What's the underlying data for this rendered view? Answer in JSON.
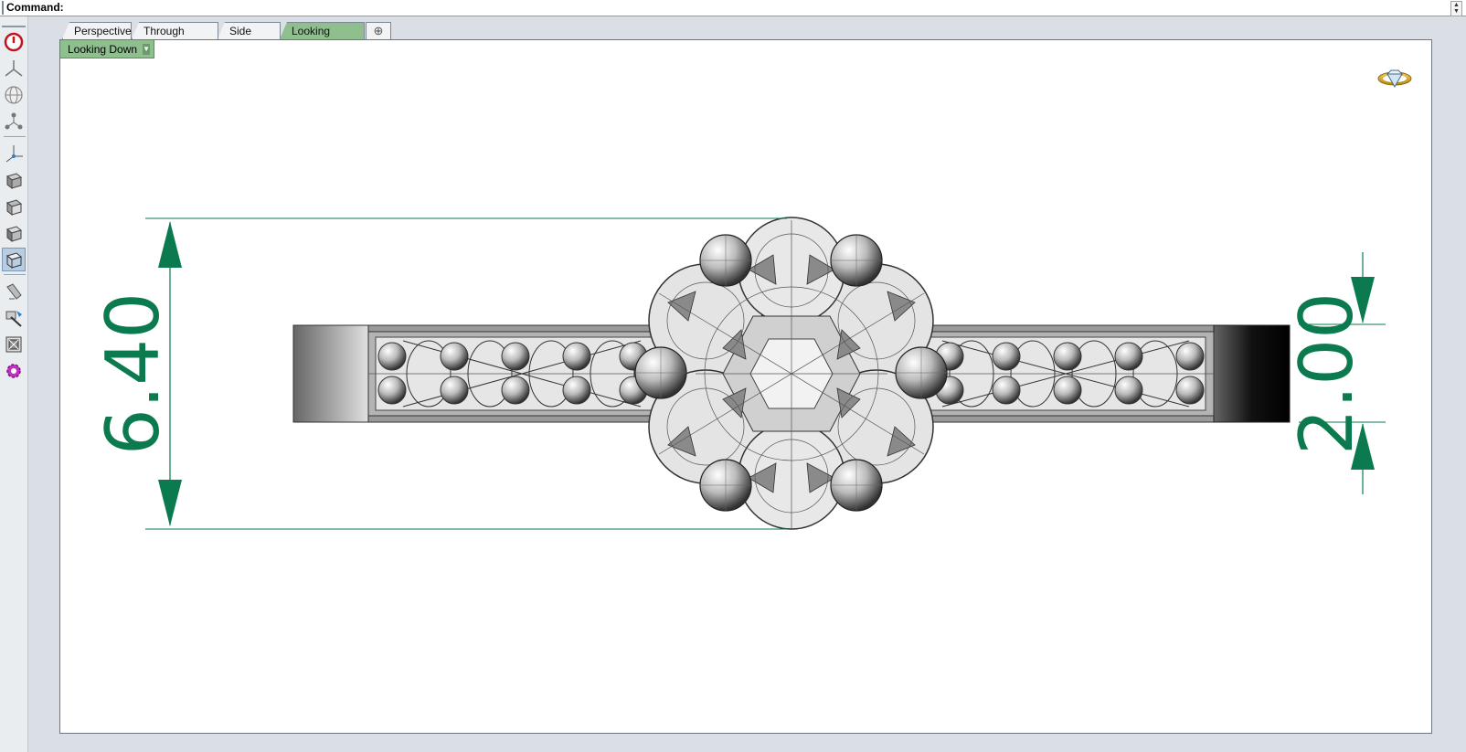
{
  "command_bar": {
    "label": "Command:"
  },
  "tabs": [
    {
      "label": "Perspective",
      "active": false
    },
    {
      "label": "Through Finger",
      "active": false
    },
    {
      "label": "Side View",
      "active": false
    },
    {
      "label": "Looking Down",
      "active": true
    }
  ],
  "add_tab_icon": "plus-icon",
  "viewport": {
    "title": "Looking Down",
    "dimensions": {
      "height_label": "6.40",
      "band_label": "2.00"
    },
    "dimension_color": "#0b7a4e"
  },
  "toolbar": {
    "buttons": [
      "power-icon",
      "axes-icon",
      "globe-icon",
      "nodes-icon",
      "separator",
      "move-axes-icon",
      "box-view-1-icon",
      "box-view-2-icon",
      "box-view-3-icon",
      "box-view-4-icon",
      "separator",
      "brush-icon",
      "tools-icon",
      "grid-box-icon",
      "gear-icon"
    ]
  },
  "colors": {
    "accent": "#8fbe8f",
    "background": "#d9dfe4"
  }
}
